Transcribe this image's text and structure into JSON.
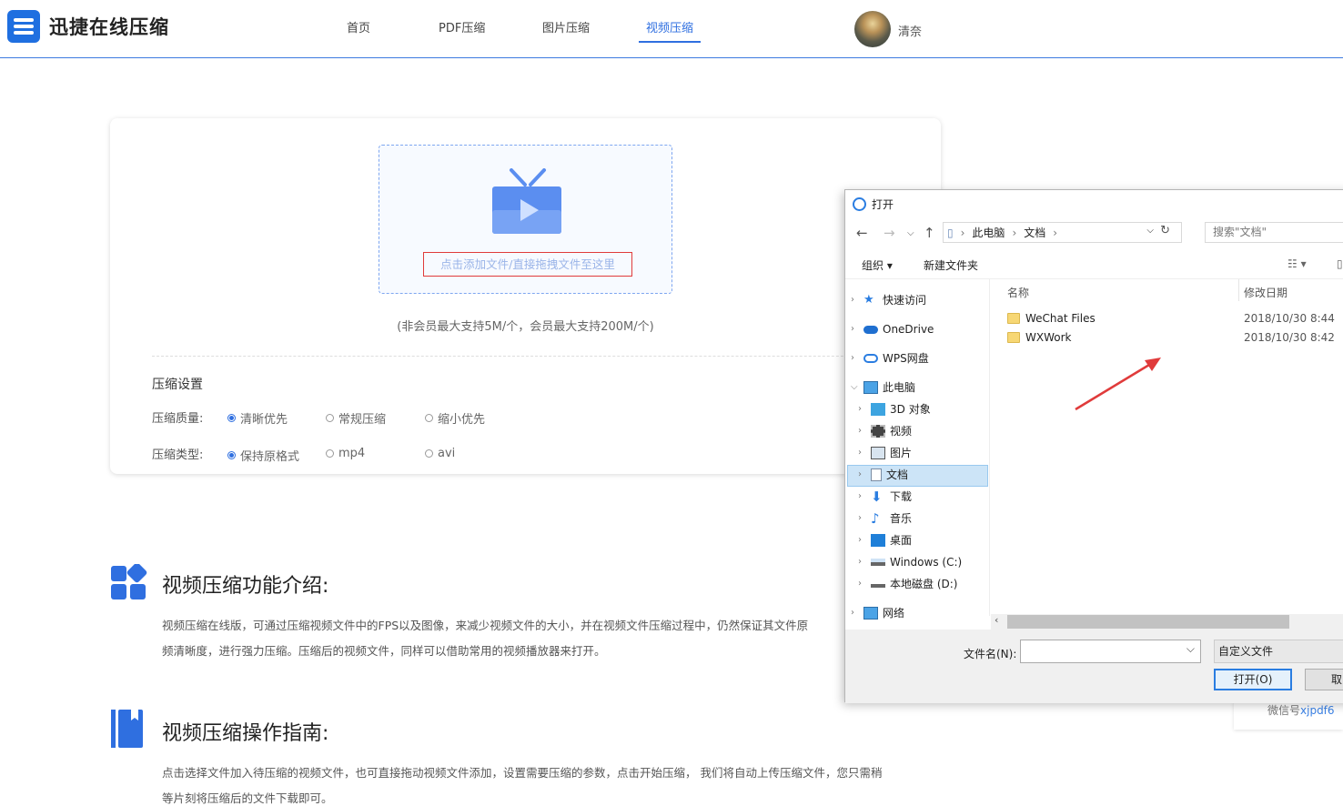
{
  "header": {
    "logo_text": "迅捷在线压缩",
    "nav": [
      "首页",
      "PDF压缩",
      "图片压缩",
      "视频压缩"
    ],
    "active_nav": "视频压缩",
    "username": "清奈"
  },
  "upload": {
    "drop_text": "点击添加文件/直接拖拽文件至这里",
    "limit_text": "(非会员最大支持5M/个，会员最大支持200M/个)"
  },
  "settings": {
    "title": "压缩设置",
    "quality_label": "压缩质量:",
    "quality_options": [
      "清晰优先",
      "常规压缩",
      "缩小优先"
    ],
    "quality_selected": "清晰优先",
    "type_label": "压缩类型:",
    "type_options": [
      "保持原格式",
      "mp4",
      "avi"
    ],
    "type_selected": "保持原格式"
  },
  "intro": {
    "title": "视频压缩功能介绍:",
    "line1": "视频压缩在线版，可通过压缩视频文件中的FPS以及图像，来减少视频文件的大小，并在视频文件压缩过程中，仍然保证其文件原",
    "line2": "频清晰度，进行强力压缩。压缩后的视频文件，同样可以借助常用的视频播放器来打开。"
  },
  "guide": {
    "title": "视频压缩操作指南:",
    "line1": "点击选择文件加入待压缩的视频文件，也可直接拖动视频文件添加，设置需要压缩的参数，点击开始压缩， 我们将自动上传压缩文件，您只需稍",
    "line2": "等片刻将压缩后的文件下载即可。"
  },
  "dialog": {
    "title": "打开",
    "path": [
      "此电脑",
      "文档"
    ],
    "search_placeholder": "搜索\"文档\"",
    "organize": "组织",
    "new_folder": "新建文件夹",
    "col_name": "名称",
    "col_date": "修改日期",
    "tree": [
      {
        "label": "快速访问",
        "icon": "star-icon",
        "level": 0
      },
      {
        "label": "OneDrive",
        "icon": "cloud-icon",
        "level": 0
      },
      {
        "label": "WPS网盘",
        "icon": "cloud-outline-icon",
        "level": 0
      },
      {
        "label": "此电脑",
        "icon": "computer-icon",
        "level": 0,
        "expanded": true
      },
      {
        "label": "3D 对象",
        "icon": "cube-icon",
        "level": 1
      },
      {
        "label": "视频",
        "icon": "film-icon",
        "level": 1
      },
      {
        "label": "图片",
        "icon": "picture-icon",
        "level": 1
      },
      {
        "label": "文档",
        "icon": "document-icon",
        "level": 1,
        "selected": true
      },
      {
        "label": "下载",
        "icon": "download-icon",
        "level": 1
      },
      {
        "label": "音乐",
        "icon": "music-icon",
        "level": 1
      },
      {
        "label": "桌面",
        "icon": "desktop-icon",
        "level": 1
      },
      {
        "label": "Windows (C:)",
        "icon": "drive-icon",
        "level": 1
      },
      {
        "label": "本地磁盘 (D:)",
        "icon": "disk-icon",
        "level": 1
      },
      {
        "label": "网络",
        "icon": "network-icon",
        "level": 0
      }
    ],
    "files": [
      {
        "name": "WeChat Files",
        "date": "2018/10/30 8:44"
      },
      {
        "name": "WXWork",
        "date": "2018/10/30 8:42"
      }
    ],
    "filename_label": "文件名(N):",
    "filename_value": "",
    "filetype": "自定义文件",
    "open_button": "打开(O)",
    "cancel_button": "取"
  },
  "wechat": {
    "label": "微信号",
    "id": "xjpdf6"
  },
  "colors": {
    "accent": "#2f6fe0",
    "highlight_border": "#e03b3b",
    "arrow": "#e03b3b"
  }
}
